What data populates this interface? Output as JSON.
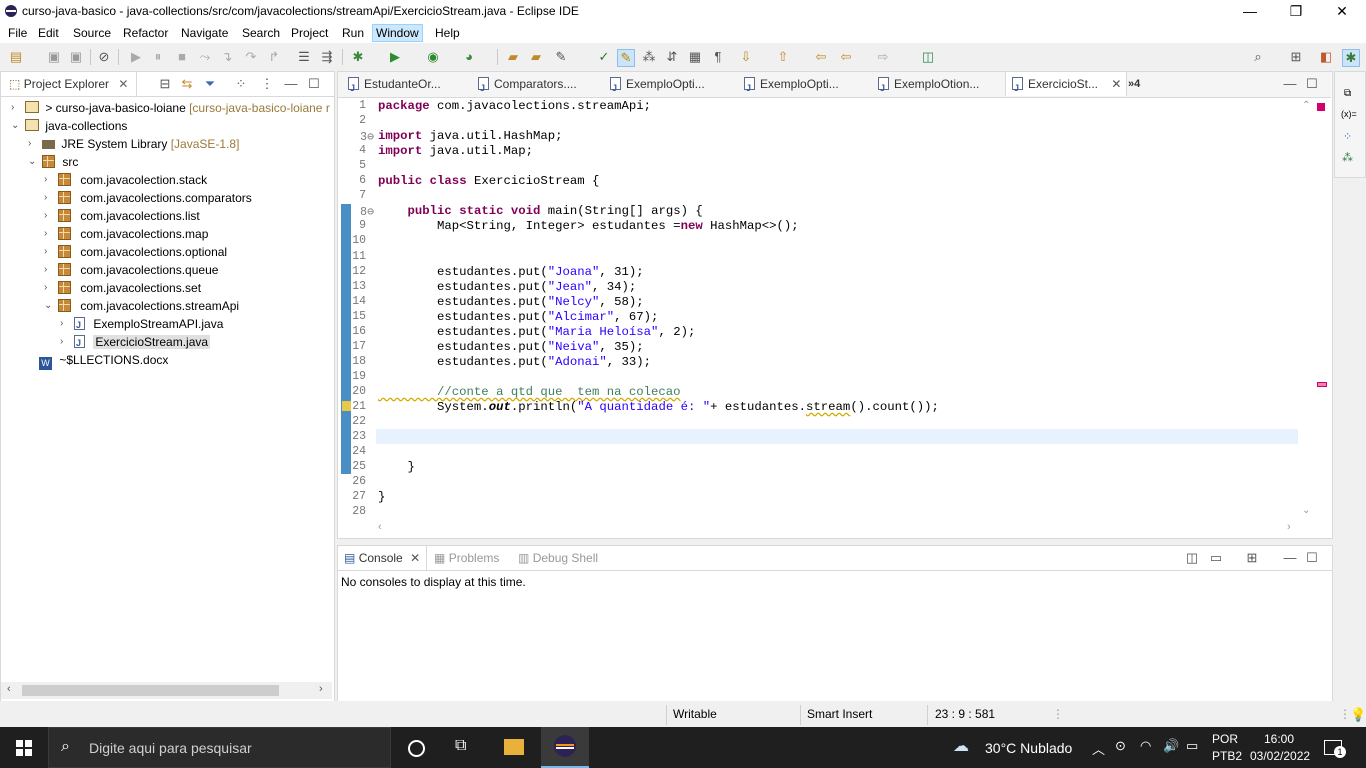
{
  "window": {
    "title": "curso-java-basico - java-collections/src/com/javacolections/streamApi/ExercicioStream.java - Eclipse IDE",
    "minimize": "—",
    "restore": "❐",
    "close": "✕"
  },
  "menu": [
    "File",
    "Edit",
    "Source",
    "Refactor",
    "Navigate",
    "Search",
    "Project",
    "Run",
    "Window",
    "Help"
  ],
  "explorer": {
    "title": "Project Explorer",
    "items": [
      {
        "label": "> curso-java-basico-loiane",
        "decorator": " [curso-java-basico-loiane r"
      },
      {
        "label": "java-collections"
      },
      {
        "label": "JRE System Library",
        "decorator": " [JavaSE-1.8]"
      },
      {
        "label": "src"
      },
      {
        "label": "com.javacolection.stack"
      },
      {
        "label": "com.javacolections.comparators"
      },
      {
        "label": "com.javacolections.list"
      },
      {
        "label": "com.javacolections.map"
      },
      {
        "label": "com.javacolections.optional"
      },
      {
        "label": "com.javacolections.queue"
      },
      {
        "label": "com.javacolections.set"
      },
      {
        "label": "com.javacolections.streamApi"
      },
      {
        "label": "ExemploStreamAPI.java"
      },
      {
        "label": "ExercicioStream.java"
      },
      {
        "label": "~$LLECTIONS.docx"
      }
    ]
  },
  "editor_tabs": [
    "EstudanteOr...",
    "Comparators....",
    "ExemploOpti...",
    "ExemploOpti...",
    "ExemploOtion...",
    "ExercicioSt..."
  ],
  "editor_tabs_overflow": "»4",
  "code_lines": [
    "package com.javacolections.streamApi;",
    "",
    "import java.util.HashMap;",
    "import java.util.Map;",
    "",
    "public class ExercicioStream {",
    "",
    "    public static void main(String[] args) {",
    "        Map<String, Integer> estudantes =new HashMap<>();",
    "",
    "",
    "        estudantes.put(\"Joana\", 31);",
    "        estudantes.put(\"Jean\", 34);",
    "        estudantes.put(\"Nelcy\", 58);",
    "        estudantes.put(\"Alcimar\", 67);",
    "        estudantes.put(\"Maria Heloísa\", 2);",
    "        estudantes.put(\"Neiva\", 35);",
    "        estudantes.put(\"Adonai\", 33);",
    "",
    "        //conte a qtd que  tem na colecao",
    "        System.out.println(\"A quantidade é: \"+ estudantes.stream().count());",
    "",
    "",
    "",
    "    }",
    "",
    "}",
    ""
  ],
  "console": {
    "tabs": [
      "Console",
      "Problems",
      "Debug Shell"
    ],
    "message": "No consoles to display at this time."
  },
  "status": {
    "writable": "Writable",
    "insert": "Smart Insert",
    "position": "23 : 9 : 581"
  },
  "taskbar": {
    "search_placeholder": "Digite aqui para pesquisar",
    "weather": "30°C  Nublado",
    "lang1": "POR",
    "lang2": "PTB2",
    "time": "16:00",
    "date": "03/02/2022",
    "notif_count": "1"
  }
}
